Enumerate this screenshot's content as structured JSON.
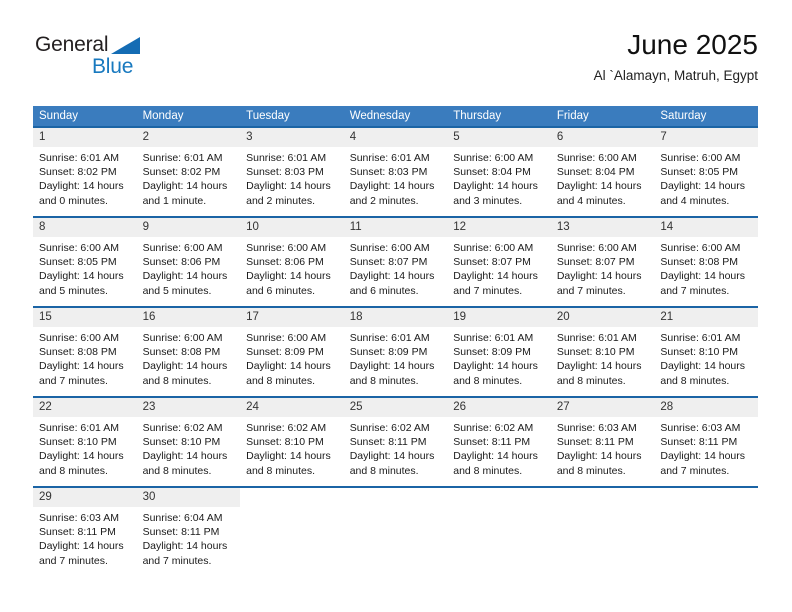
{
  "brand": {
    "name_top": "General",
    "name_bottom": "Blue",
    "accent_color": "#1879bf",
    "triangle_color": "#146cb4"
  },
  "header": {
    "title": "June 2025",
    "subtitle": "Al `Alamayn, Matruh, Egypt"
  },
  "theme": {
    "header_row_bg": "#3a7cbe",
    "row_divider": "#1b64a5",
    "daynum_bg": "#efefef",
    "text": "#1a1a1a"
  },
  "weekday_headers": [
    "Sunday",
    "Monday",
    "Tuesday",
    "Wednesday",
    "Thursday",
    "Friday",
    "Saturday"
  ],
  "weeks": [
    [
      {
        "day": "1",
        "sunrise": "Sunrise: 6:01 AM",
        "sunset": "Sunset: 8:02 PM",
        "daylight_1": "Daylight: 14 hours",
        "daylight_2": "and 0 minutes."
      },
      {
        "day": "2",
        "sunrise": "Sunrise: 6:01 AM",
        "sunset": "Sunset: 8:02 PM",
        "daylight_1": "Daylight: 14 hours",
        "daylight_2": "and 1 minute."
      },
      {
        "day": "3",
        "sunrise": "Sunrise: 6:01 AM",
        "sunset": "Sunset: 8:03 PM",
        "daylight_1": "Daylight: 14 hours",
        "daylight_2": "and 2 minutes."
      },
      {
        "day": "4",
        "sunrise": "Sunrise: 6:01 AM",
        "sunset": "Sunset: 8:03 PM",
        "daylight_1": "Daylight: 14 hours",
        "daylight_2": "and 2 minutes."
      },
      {
        "day": "5",
        "sunrise": "Sunrise: 6:00 AM",
        "sunset": "Sunset: 8:04 PM",
        "daylight_1": "Daylight: 14 hours",
        "daylight_2": "and 3 minutes."
      },
      {
        "day": "6",
        "sunrise": "Sunrise: 6:00 AM",
        "sunset": "Sunset: 8:04 PM",
        "daylight_1": "Daylight: 14 hours",
        "daylight_2": "and 4 minutes."
      },
      {
        "day": "7",
        "sunrise": "Sunrise: 6:00 AM",
        "sunset": "Sunset: 8:05 PM",
        "daylight_1": "Daylight: 14 hours",
        "daylight_2": "and 4 minutes."
      }
    ],
    [
      {
        "day": "8",
        "sunrise": "Sunrise: 6:00 AM",
        "sunset": "Sunset: 8:05 PM",
        "daylight_1": "Daylight: 14 hours",
        "daylight_2": "and 5 minutes."
      },
      {
        "day": "9",
        "sunrise": "Sunrise: 6:00 AM",
        "sunset": "Sunset: 8:06 PM",
        "daylight_1": "Daylight: 14 hours",
        "daylight_2": "and 5 minutes."
      },
      {
        "day": "10",
        "sunrise": "Sunrise: 6:00 AM",
        "sunset": "Sunset: 8:06 PM",
        "daylight_1": "Daylight: 14 hours",
        "daylight_2": "and 6 minutes."
      },
      {
        "day": "11",
        "sunrise": "Sunrise: 6:00 AM",
        "sunset": "Sunset: 8:07 PM",
        "daylight_1": "Daylight: 14 hours",
        "daylight_2": "and 6 minutes."
      },
      {
        "day": "12",
        "sunrise": "Sunrise: 6:00 AM",
        "sunset": "Sunset: 8:07 PM",
        "daylight_1": "Daylight: 14 hours",
        "daylight_2": "and 7 minutes."
      },
      {
        "day": "13",
        "sunrise": "Sunrise: 6:00 AM",
        "sunset": "Sunset: 8:07 PM",
        "daylight_1": "Daylight: 14 hours",
        "daylight_2": "and 7 minutes."
      },
      {
        "day": "14",
        "sunrise": "Sunrise: 6:00 AM",
        "sunset": "Sunset: 8:08 PM",
        "daylight_1": "Daylight: 14 hours",
        "daylight_2": "and 7 minutes."
      }
    ],
    [
      {
        "day": "15",
        "sunrise": "Sunrise: 6:00 AM",
        "sunset": "Sunset: 8:08 PM",
        "daylight_1": "Daylight: 14 hours",
        "daylight_2": "and 7 minutes."
      },
      {
        "day": "16",
        "sunrise": "Sunrise: 6:00 AM",
        "sunset": "Sunset: 8:08 PM",
        "daylight_1": "Daylight: 14 hours",
        "daylight_2": "and 8 minutes."
      },
      {
        "day": "17",
        "sunrise": "Sunrise: 6:00 AM",
        "sunset": "Sunset: 8:09 PM",
        "daylight_1": "Daylight: 14 hours",
        "daylight_2": "and 8 minutes."
      },
      {
        "day": "18",
        "sunrise": "Sunrise: 6:01 AM",
        "sunset": "Sunset: 8:09 PM",
        "daylight_1": "Daylight: 14 hours",
        "daylight_2": "and 8 minutes."
      },
      {
        "day": "19",
        "sunrise": "Sunrise: 6:01 AM",
        "sunset": "Sunset: 8:09 PM",
        "daylight_1": "Daylight: 14 hours",
        "daylight_2": "and 8 minutes."
      },
      {
        "day": "20",
        "sunrise": "Sunrise: 6:01 AM",
        "sunset": "Sunset: 8:10 PM",
        "daylight_1": "Daylight: 14 hours",
        "daylight_2": "and 8 minutes."
      },
      {
        "day": "21",
        "sunrise": "Sunrise: 6:01 AM",
        "sunset": "Sunset: 8:10 PM",
        "daylight_1": "Daylight: 14 hours",
        "daylight_2": "and 8 minutes."
      }
    ],
    [
      {
        "day": "22",
        "sunrise": "Sunrise: 6:01 AM",
        "sunset": "Sunset: 8:10 PM",
        "daylight_1": "Daylight: 14 hours",
        "daylight_2": "and 8 minutes."
      },
      {
        "day": "23",
        "sunrise": "Sunrise: 6:02 AM",
        "sunset": "Sunset: 8:10 PM",
        "daylight_1": "Daylight: 14 hours",
        "daylight_2": "and 8 minutes."
      },
      {
        "day": "24",
        "sunrise": "Sunrise: 6:02 AM",
        "sunset": "Sunset: 8:10 PM",
        "daylight_1": "Daylight: 14 hours",
        "daylight_2": "and 8 minutes."
      },
      {
        "day": "25",
        "sunrise": "Sunrise: 6:02 AM",
        "sunset": "Sunset: 8:11 PM",
        "daylight_1": "Daylight: 14 hours",
        "daylight_2": "and 8 minutes."
      },
      {
        "day": "26",
        "sunrise": "Sunrise: 6:02 AM",
        "sunset": "Sunset: 8:11 PM",
        "daylight_1": "Daylight: 14 hours",
        "daylight_2": "and 8 minutes."
      },
      {
        "day": "27",
        "sunrise": "Sunrise: 6:03 AM",
        "sunset": "Sunset: 8:11 PM",
        "daylight_1": "Daylight: 14 hours",
        "daylight_2": "and 8 minutes."
      },
      {
        "day": "28",
        "sunrise": "Sunrise: 6:03 AM",
        "sunset": "Sunset: 8:11 PM",
        "daylight_1": "Daylight: 14 hours",
        "daylight_2": "and 7 minutes."
      }
    ],
    [
      {
        "day": "29",
        "sunrise": "Sunrise: 6:03 AM",
        "sunset": "Sunset: 8:11 PM",
        "daylight_1": "Daylight: 14 hours",
        "daylight_2": "and 7 minutes."
      },
      {
        "day": "30",
        "sunrise": "Sunrise: 6:04 AM",
        "sunset": "Sunset: 8:11 PM",
        "daylight_1": "Daylight: 14 hours",
        "daylight_2": "and 7 minutes."
      },
      {
        "day": "",
        "sunrise": "",
        "sunset": "",
        "daylight_1": "",
        "daylight_2": ""
      },
      {
        "day": "",
        "sunrise": "",
        "sunset": "",
        "daylight_1": "",
        "daylight_2": ""
      },
      {
        "day": "",
        "sunrise": "",
        "sunset": "",
        "daylight_1": "",
        "daylight_2": ""
      },
      {
        "day": "",
        "sunrise": "",
        "sunset": "",
        "daylight_1": "",
        "daylight_2": ""
      },
      {
        "day": "",
        "sunrise": "",
        "sunset": "",
        "daylight_1": "",
        "daylight_2": ""
      }
    ]
  ]
}
